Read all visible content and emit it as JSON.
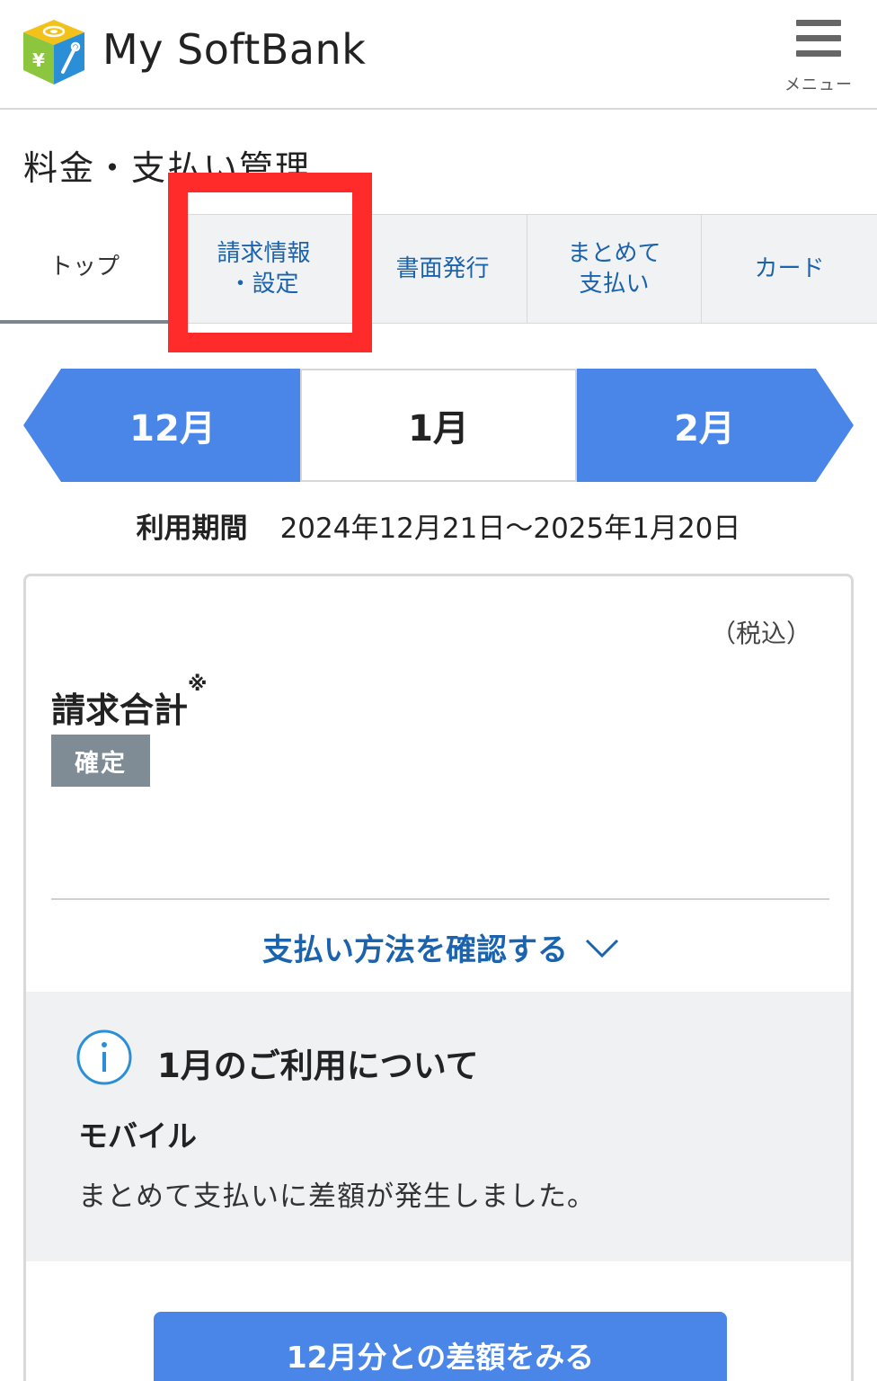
{
  "header": {
    "brand": "My SoftBank",
    "menu_label": "メニュー"
  },
  "page_title": "料金・支払い管理",
  "tabs": [
    {
      "label": "トップ",
      "active": true
    },
    {
      "label_line1": "請求情報",
      "label_line2": "・設定",
      "active": false
    },
    {
      "label": "書面発行",
      "active": false
    },
    {
      "label_line1": "まとめて",
      "label_line2": "支払い",
      "active": false
    },
    {
      "label": "カード",
      "active": false
    }
  ],
  "months": {
    "prev": "12月",
    "current": "1月",
    "next": "2月"
  },
  "period": {
    "label": "利用期間",
    "value": "2024年12月21日〜2025年1月20日"
  },
  "billing": {
    "tax_note": "（税込）",
    "total_label": "請求合計",
    "total_mark": "※",
    "status_badge": "確定",
    "payment_link": "支払い方法を確認する"
  },
  "notice": {
    "title": "1月のご利用について",
    "subtitle": "モバイル",
    "body": "まとめて支払いに差額が発生しました。"
  },
  "diff_button": "12月分との差額をみる",
  "colors": {
    "accent_blue": "#4a86e8",
    "link_blue": "#1c63ad",
    "highlight_red": "#ff2a2a",
    "badge_gray": "#7f8c96"
  }
}
